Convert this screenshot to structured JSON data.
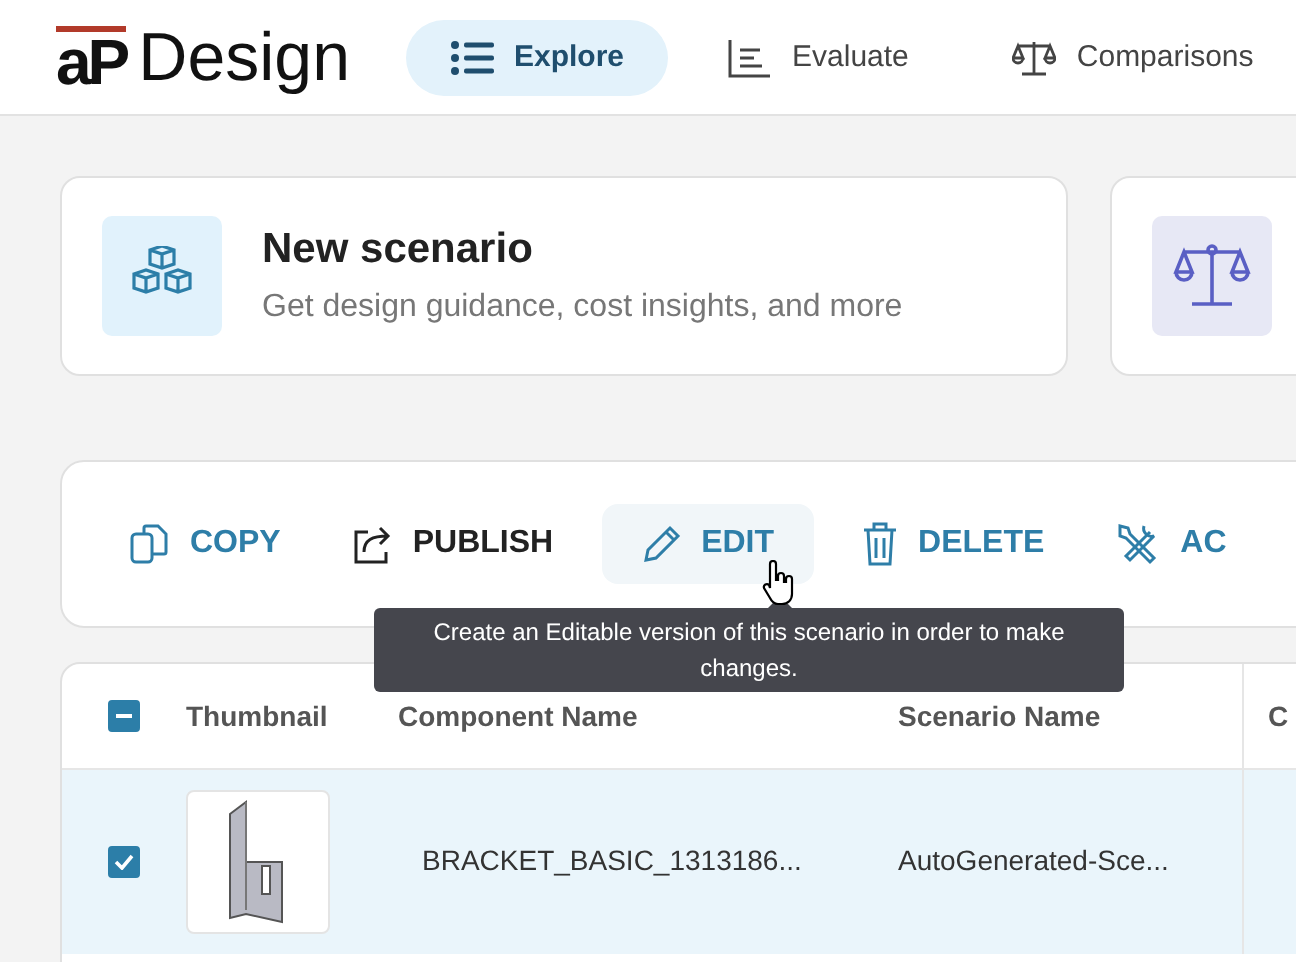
{
  "app": {
    "logo_mark": "aP",
    "name": "Design"
  },
  "nav": [
    {
      "label": "Explore",
      "kind": "list",
      "selected": true
    },
    {
      "label": "Evaluate",
      "kind": "chart",
      "selected": false
    },
    {
      "label": "Comparisons",
      "kind": "scale",
      "selected": false
    }
  ],
  "cards": [
    {
      "title": "New scenario",
      "subtitle": "Get design guidance, cost insights, and more"
    }
  ],
  "actions": [
    {
      "label": "COPY",
      "kind": "copy",
      "hovered": false,
      "disabled": false
    },
    {
      "label": "PUBLISH",
      "kind": "publish",
      "hovered": false,
      "disabled": true
    },
    {
      "label": "EDIT",
      "kind": "edit",
      "hovered": true,
      "disabled": false
    },
    {
      "label": "DELETE",
      "kind": "delete",
      "hovered": false,
      "disabled": false
    },
    {
      "label": "AC",
      "kind": "tools",
      "hovered": false,
      "disabled": false
    }
  ],
  "tooltip": "Create an Editable version of this scenario in order to make changes.",
  "table": {
    "select_all": {
      "indeterminate": true
    },
    "columns": [
      "Thumbnail",
      "Component Name",
      "Scenario Name",
      "C"
    ],
    "rows": [
      {
        "component_name": "BRACKET_BASIC_1313186...",
        "scenario_name": "AutoGenerated-Sce...",
        "selected": true,
        "checked": true
      }
    ]
  }
}
